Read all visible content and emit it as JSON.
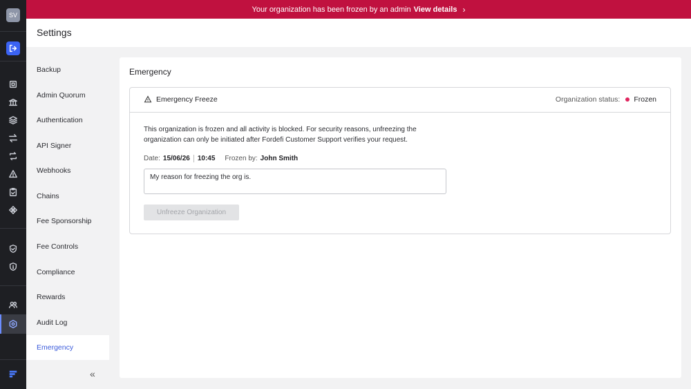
{
  "user": {
    "initials": "SV"
  },
  "banner": {
    "message": "Your organization has been frozen by an admin",
    "link_label": "View details",
    "chevron": "›"
  },
  "header": {
    "title": "Settings"
  },
  "rail_icons": [
    "logout-icon",
    "dashboard-icon",
    "bank-icon",
    "layers-icon",
    "transfer-icon",
    "swap-icon",
    "alert-icon",
    "clipboard-icon",
    "nodes-icon",
    "shield-check-icon",
    "shield-lock-icon",
    "users-icon",
    "settings-icon",
    "brand-logo-icon"
  ],
  "subnav": {
    "items": [
      {
        "label": "Backup"
      },
      {
        "label": "Admin Quorum"
      },
      {
        "label": "Authentication"
      },
      {
        "label": "API Signer"
      },
      {
        "label": "Webhooks"
      },
      {
        "label": "Chains"
      },
      {
        "label": "Fee Sponsorship"
      },
      {
        "label": "Fee Controls"
      },
      {
        "label": "Compliance"
      },
      {
        "label": "Rewards"
      },
      {
        "label": "Audit Log"
      },
      {
        "label": "Emergency"
      }
    ],
    "active": "Emergency",
    "collapse_glyph": "«"
  },
  "main": {
    "section_title": "Emergency",
    "panel": {
      "title": "Emergency Freeze",
      "status_label": "Organization status:",
      "status_value": "Frozen",
      "status_color": "#e0245e",
      "description": "This organization is frozen and all activity is blocked. For security reasons, unfreezing the organization can only be initiated after Fordefi Customer Support verifies your request.",
      "date_label": "Date:",
      "date_value": "15/06/26",
      "time_value": "10:45",
      "frozen_by_label": "Frozen by:",
      "frozen_by_value": "John Smith",
      "reason_text": "My reason for freezing the org is.",
      "unfreeze_label": "Unfreeze Organization"
    }
  },
  "colors": {
    "banner": "#c0113f",
    "accent": "#3b5bdb",
    "rail": "#1e1f23"
  }
}
